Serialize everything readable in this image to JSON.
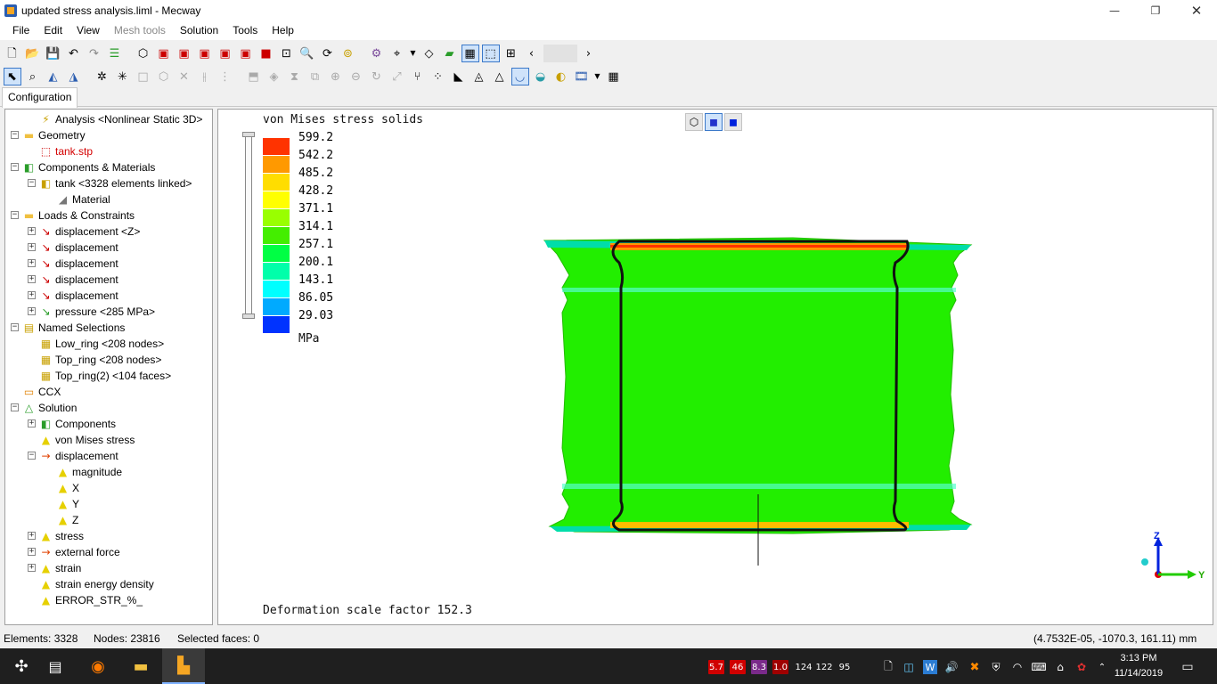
{
  "window": {
    "title": "updated stress analysis.liml - Mecway",
    "minimize_icon": "minimize-icon",
    "restore_icon": "restore-icon",
    "close_icon": "close-icon"
  },
  "menu": [
    {
      "label": "File",
      "enabled": true
    },
    {
      "label": "Edit",
      "enabled": true
    },
    {
      "label": "View",
      "enabled": true
    },
    {
      "label": "Mesh tools",
      "enabled": false
    },
    {
      "label": "Solution",
      "enabled": true
    },
    {
      "label": "Tools",
      "enabled": true
    },
    {
      "label": "Help",
      "enabled": true
    }
  ],
  "tabs": {
    "configuration": "Configuration"
  },
  "tree": [
    {
      "label": "Analysis <Nonlinear Static 3D>",
      "icon": "lightning-icon"
    },
    {
      "label": "Geometry",
      "icon": "folder-icon"
    },
    {
      "label": "tank.stp",
      "icon": "geometry-file-icon",
      "color": "#d40000"
    },
    {
      "label": "Components & Materials",
      "icon": "components-icon"
    },
    {
      "label": "tank <3328 elements linked>",
      "icon": "component-icon"
    },
    {
      "label": "Material",
      "icon": "material-icon"
    },
    {
      "label": "Loads & Constraints",
      "icon": "loads-folder-icon"
    },
    {
      "label": "displacement <Z>",
      "icon": "displacement-constraint-icon"
    },
    {
      "label": "displacement",
      "icon": "displacement-constraint-icon"
    },
    {
      "label": "displacement",
      "icon": "displacement-constraint-icon"
    },
    {
      "label": "displacement",
      "icon": "displacement-constraint-icon"
    },
    {
      "label": "displacement",
      "icon": "displacement-constraint-icon"
    },
    {
      "label": "pressure <285 MPa>",
      "icon": "pressure-icon"
    },
    {
      "label": "Named Selections",
      "icon": "named-selections-folder-icon"
    },
    {
      "label": "Low_ring <208 nodes>",
      "icon": "selection-icon"
    },
    {
      "label": "Top_ring <208 nodes>",
      "icon": "selection-icon"
    },
    {
      "label": "Top_ring(2) <104 faces>",
      "icon": "selection-icon"
    },
    {
      "label": "CCX",
      "icon": "ccx-icon"
    },
    {
      "label": "Solution",
      "icon": "solution-icon"
    },
    {
      "label": "Components",
      "icon": "components-icon"
    },
    {
      "label": "von Mises stress",
      "icon": "result-icon"
    },
    {
      "label": "displacement",
      "icon": "vector-result-icon"
    },
    {
      "label": "magnitude",
      "icon": "result-icon"
    },
    {
      "label": "X",
      "icon": "result-icon"
    },
    {
      "label": "Y",
      "icon": "result-icon"
    },
    {
      "label": "Z",
      "icon": "result-icon"
    },
    {
      "label": "stress",
      "icon": "result-icon"
    },
    {
      "label": "external force",
      "icon": "vector-result-icon"
    },
    {
      "label": "strain",
      "icon": "result-icon"
    },
    {
      "label": "strain energy density",
      "icon": "result-icon"
    },
    {
      "label": "ERROR_STR_%_",
      "icon": "result-icon"
    }
  ],
  "viewport": {
    "legend_title": "von Mises stress solids",
    "legend_values": [
      "599.2",
      "542.2",
      "485.2",
      "428.2",
      "371.1",
      "314.1",
      "257.1",
      "200.1",
      "143.1",
      "86.05",
      "29.03"
    ],
    "legend_colors": [
      "#ff3300",
      "#ff9900",
      "#ffdd00",
      "#ffff00",
      "#99ff00",
      "#44ee00",
      "#00ff44",
      "#00ffaa",
      "#00ffff",
      "#00aaff",
      "#0033ff"
    ],
    "units": "MPa",
    "deformation_text": "Deformation scale factor 152.3",
    "triad_labels": {
      "z": "Z",
      "y": "Y"
    },
    "model_color": "#22ee00"
  },
  "status": {
    "elements": "Elements: 3328",
    "nodes": "Nodes: 23816",
    "selected_faces": "Selected faces: 0",
    "coordinates": "(4.7532E-05, -1070.3, 161.11) mm"
  },
  "taskbar": {
    "tray_values": [
      "5.7",
      "46",
      "8.3",
      "1.0",
      "124",
      "122",
      "95"
    ],
    "tray_colors": [
      "#d00000",
      "#d00000",
      "#7a2a8a",
      "#a00000"
    ],
    "time": "3:13 PM",
    "date": "11/14/2019"
  }
}
